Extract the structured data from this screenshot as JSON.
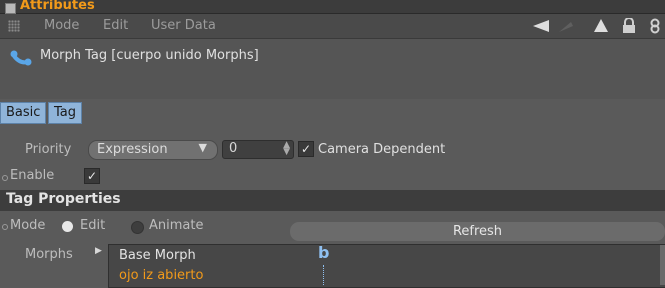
{
  "window": {
    "title": "Attributes"
  },
  "menu": {
    "items": [
      "Mode",
      "Edit",
      "User Data"
    ]
  },
  "toolbar": {
    "icons": [
      "back-arrow-icon",
      "forward-arrow-icon",
      "up-arrow-icon",
      "lock-icon",
      "link-icon"
    ]
  },
  "object": {
    "name": "Morph Tag [cuerpo unido Morphs]"
  },
  "tabs": [
    "Basic",
    "Tag"
  ],
  "basic": {
    "priority_label": "Priority",
    "priority_value": "Expression",
    "priority_number": "0",
    "camera_dependent_label": "Camera Dependent",
    "enable_label": "Enable"
  },
  "tag_properties": {
    "section_title": "Tag Properties",
    "mode_label": "Mode",
    "mode_edit": "Edit",
    "mode_animate": "Animate",
    "refresh_label": "Refresh",
    "morphs_label": "Morphs",
    "morph_items": [
      "Base Morph",
      "ojo iz abierto"
    ],
    "column_marker": "b"
  },
  "colors": {
    "accent": "#f29a1a",
    "tab": "#8fb4d9"
  }
}
